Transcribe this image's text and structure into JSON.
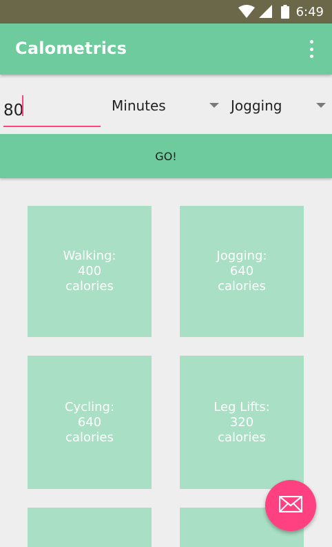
{
  "status_bar": {
    "time": "6:49",
    "icons": [
      "wifi-icon",
      "cell-signal-icon",
      "battery-icon"
    ]
  },
  "app_bar": {
    "title": "Calometrics",
    "overflow_icon": "more-vert-icon"
  },
  "input": {
    "duration_value": "80",
    "unit_selected": "Minutes",
    "activity_selected": "Jogging"
  },
  "go_button": {
    "label": "GO!"
  },
  "results": [
    {
      "text": "Walking:\n400\ncalories"
    },
    {
      "text": "Jogging:\n640\ncalories"
    },
    {
      "text": "Cycling:\n640\ncalories"
    },
    {
      "text": "Leg Lifts:\n320\ncalories"
    },
    {
      "text": ""
    },
    {
      "text": ""
    }
  ],
  "fab": {
    "icon": "email-icon"
  },
  "colors": {
    "status_bar": "#6b6749",
    "primary": "#6ecb9d",
    "card": "#a9dfc4",
    "accent": "#ff4081",
    "background": "#eeeeee"
  }
}
